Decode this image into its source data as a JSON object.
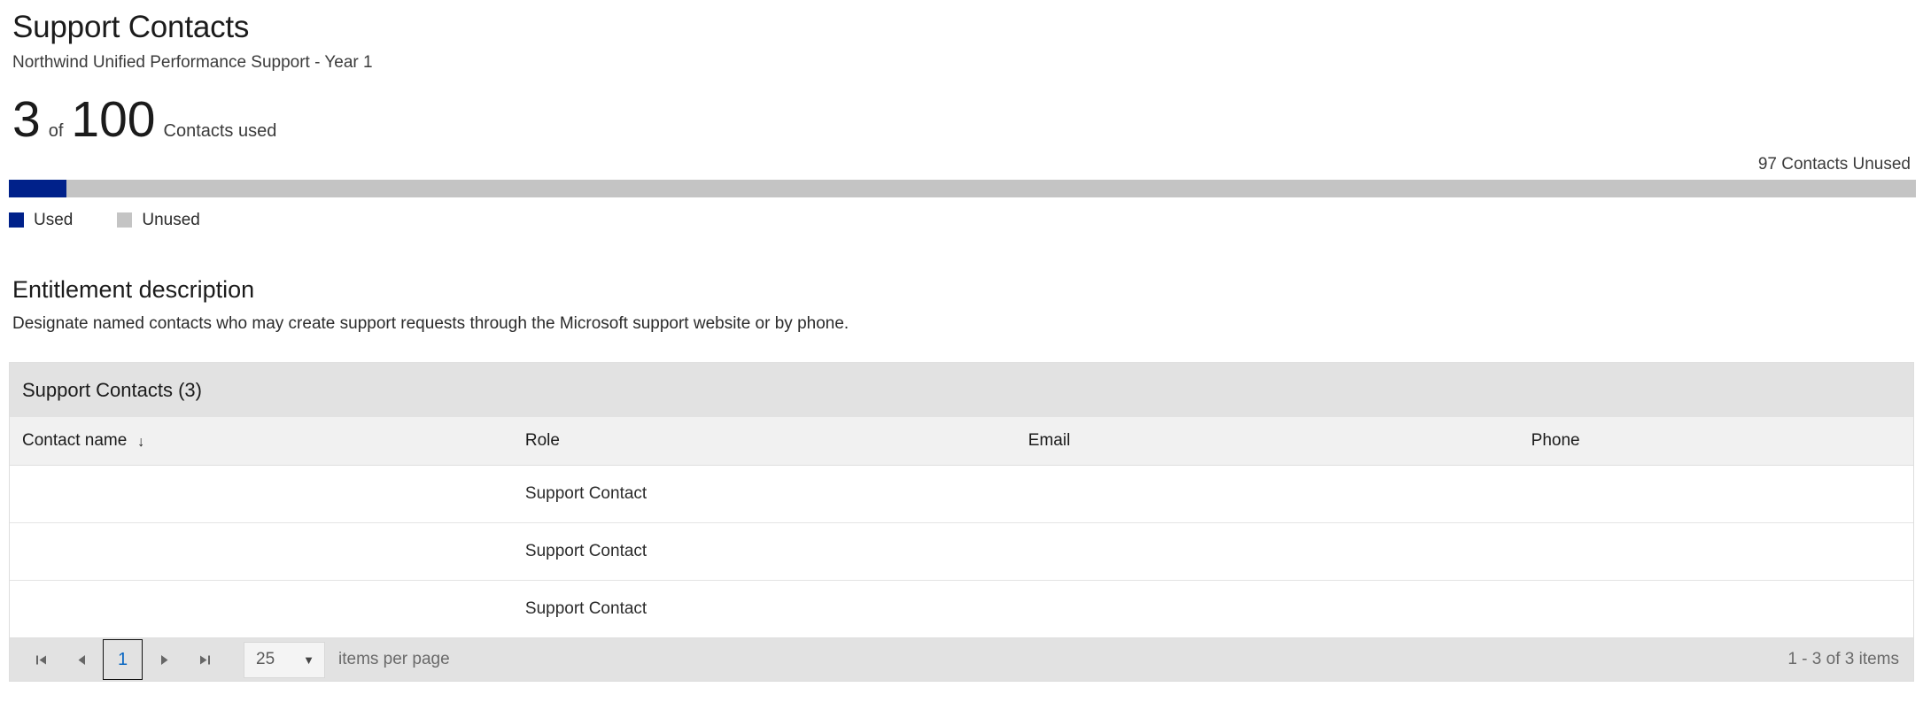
{
  "header": {
    "title": "Support Contacts",
    "subtitle": "Northwind Unified Performance Support - Year 1"
  },
  "usage": {
    "used": "3",
    "of_word": "of",
    "total": "100",
    "label": "Contacts used",
    "unused_label": "97 Contacts Unused",
    "used_percent": 3,
    "colors": {
      "used": "#00218a",
      "unused": "#c4c4c4"
    },
    "legend": [
      {
        "label": "Used",
        "color": "#00218a"
      },
      {
        "label": "Unused",
        "color": "#c4c4c4"
      }
    ]
  },
  "entitlement": {
    "title": "Entitlement description",
    "body": "Designate named contacts who may create support requests through the Microsoft support website or by phone."
  },
  "grid": {
    "caption": "Support Contacts (3)",
    "sort_icon": "↓",
    "columns": [
      {
        "label": "Contact name",
        "sorted": true
      },
      {
        "label": "Role",
        "sorted": false
      },
      {
        "label": "Email",
        "sorted": false
      },
      {
        "label": "Phone",
        "sorted": false
      }
    ],
    "rows": [
      {
        "contact_name": "",
        "role": "Support Contact",
        "email": "",
        "phone": ""
      },
      {
        "contact_name": "",
        "role": "Support Contact",
        "email": "",
        "phone": ""
      },
      {
        "contact_name": "",
        "role": "Support Contact",
        "email": "",
        "phone": ""
      }
    ]
  },
  "pager": {
    "first_icon": "|◀",
    "prev_icon": "◀",
    "current_page": "1",
    "next_icon": "▶",
    "last_icon": "▶|",
    "page_size": "25",
    "caret_icon": "▼",
    "items_per_page_label": "items per page",
    "range_label": "1 - 3 of 3 items"
  }
}
